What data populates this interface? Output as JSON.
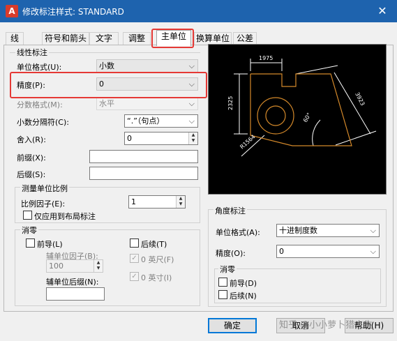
{
  "window": {
    "title": "修改标注样式: STANDARD",
    "icon": "autocad-icon",
    "close_glyph": "✕"
  },
  "tabs": [
    {
      "label": "线"
    },
    {
      "label": "符号和箭头"
    },
    {
      "label": "文字"
    },
    {
      "label": "调整"
    },
    {
      "label": "主单位"
    },
    {
      "label": "换算单位"
    },
    {
      "label": "公差"
    }
  ],
  "linear": {
    "group_label": "线性标注",
    "unit_format": {
      "label": "单位格式(U):",
      "value": "小数"
    },
    "precision": {
      "label": "精度(P):",
      "value": "0"
    },
    "fraction_format": {
      "label": "分数格式(M):",
      "value": "水平"
    },
    "decimal_separator": {
      "label": "小数分隔符(C):",
      "value": "“.”（句点）"
    },
    "round_off": {
      "label": "舍入(R):",
      "value": "0"
    },
    "prefix": {
      "label": "前缀(X):",
      "value": ""
    },
    "suffix": {
      "label": "后缀(S):",
      "value": ""
    }
  },
  "scale": {
    "group_label": "测量单位比例",
    "factor_label": "比例因子(E):",
    "factor_value": "1",
    "layout_only_label": "仅应用到布局标注"
  },
  "zero_suppression": {
    "group_label": "消零",
    "leading_label": "前导(L)",
    "sub_unit_factor_label": "辅单位因子(B):",
    "sub_unit_factor_value": "100",
    "sub_unit_suffix_label": "辅单位后缀(N):",
    "trailing_label": "后续(T)",
    "feet_label": "0 英尺(F)",
    "inches_label": "0 英寸(I)",
    "check_glyph": "✓"
  },
  "preview": {
    "dim_top": "1975",
    "dim_left": "2325",
    "dim_right": "3923",
    "dim_angle": "60°",
    "dim_radius": "R1564",
    "accent_color": "#d4892a"
  },
  "angular": {
    "group_label": "角度标注",
    "unit_format": {
      "label": "单位格式(A):",
      "value": "十进制度数"
    },
    "precision": {
      "label": "精度(O):",
      "value": "0"
    },
    "zero_group_label": "消零",
    "leading_label": "前导(D)",
    "trailing_label": "后续(N)"
  },
  "buttons": {
    "ok": "确定",
    "cancel": "取消",
    "help": "帮助(H)"
  },
  "watermark": "知乎 @小小萝卜猎人生",
  "highlight_color": "#e53935"
}
